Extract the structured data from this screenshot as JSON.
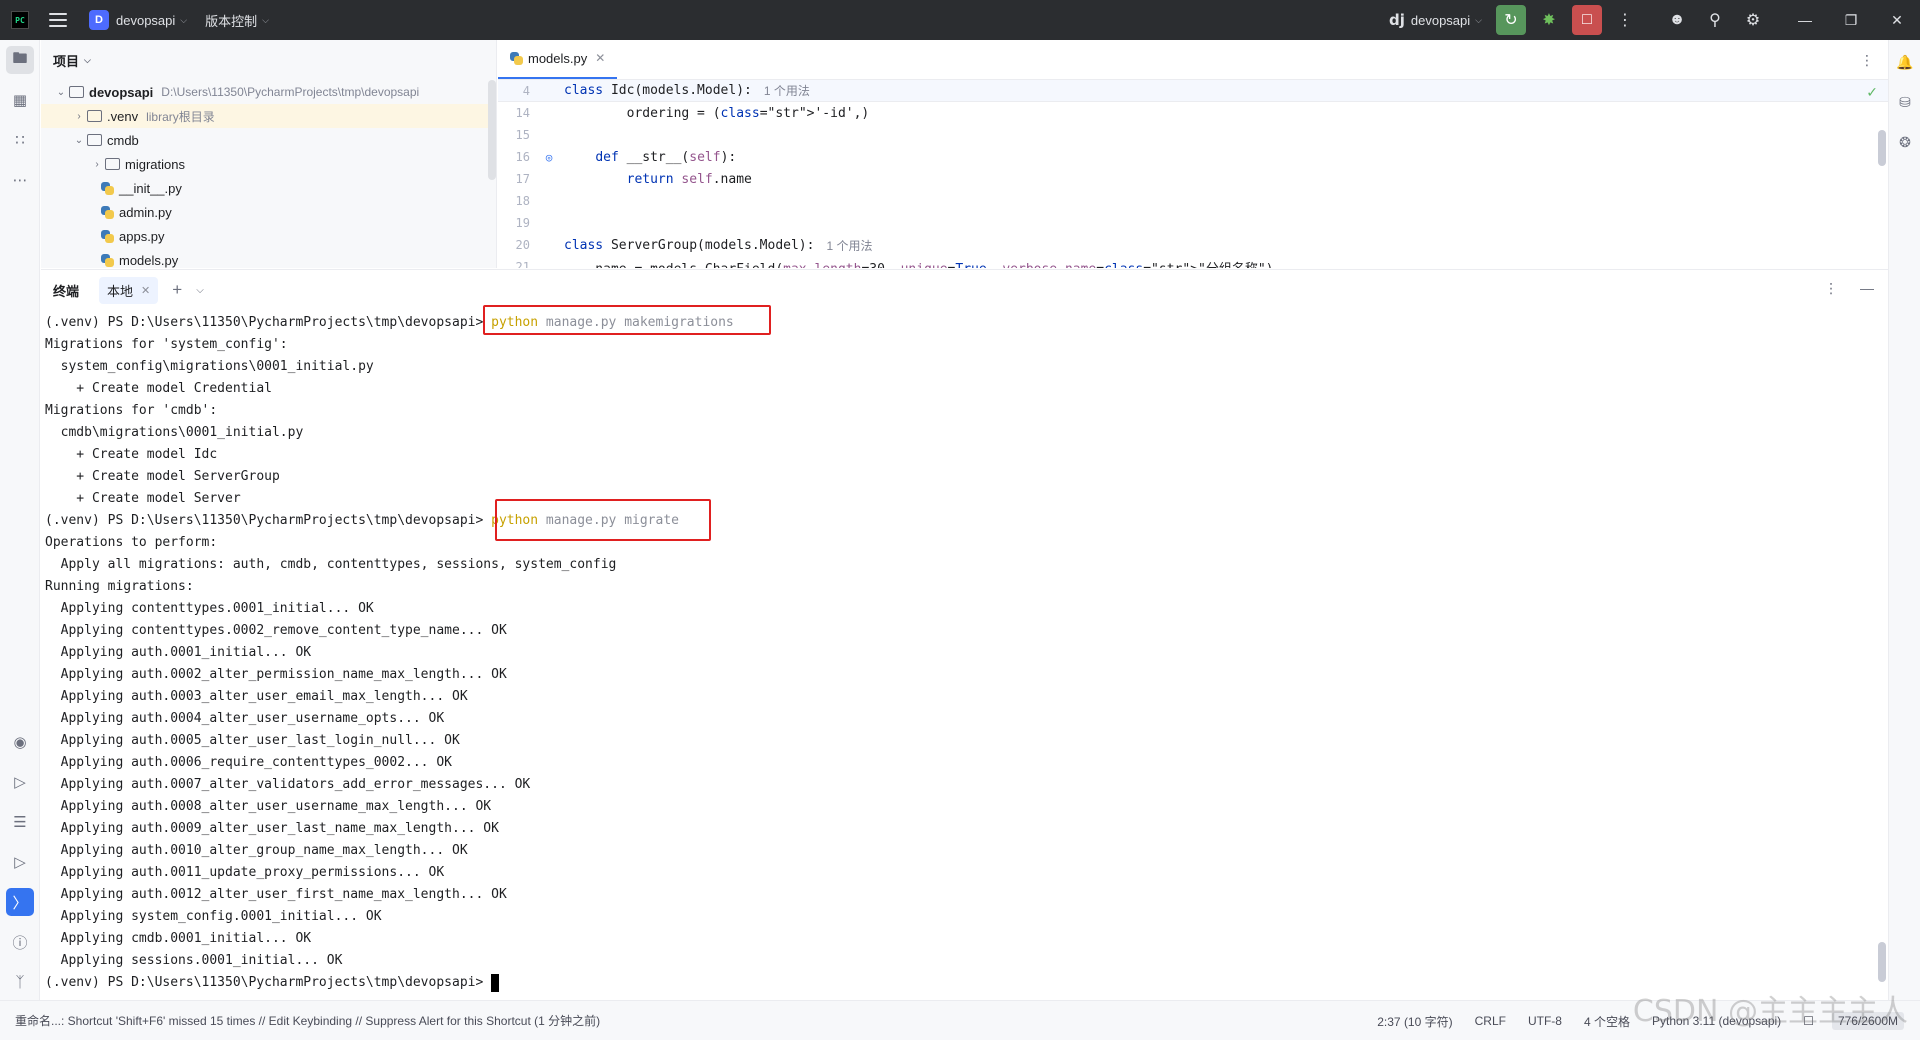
{
  "titlebar": {
    "logo": "PC",
    "project_badge": "D",
    "project_name": "devopsapi",
    "vcs_label": "版本控制",
    "dj_logo": "dj",
    "run_config": "devopsapi",
    "icons": [
      "hamburger-menu-icon",
      "rerun-icon",
      "debug-icon",
      "stop-icon",
      "more-icon",
      "add-user-icon",
      "search-icon",
      "gear-icon",
      "minimize-icon",
      "restore-icon",
      "close-icon"
    ]
  },
  "project_panel": {
    "title": "项目",
    "tree": [
      {
        "label": "devopsapi",
        "hint": "D:\\Users\\11350\\PycharmProjects\\tmp\\devopsapi",
        "type": "folder",
        "expanded": true
      },
      {
        "label": ".venv",
        "hint": "library根目录",
        "type": "folder",
        "expanded": false
      },
      {
        "label": "cmdb",
        "hint": "",
        "type": "folder",
        "expanded": true
      },
      {
        "label": "migrations",
        "hint": "",
        "type": "folder",
        "expanded": false
      },
      {
        "label": "__init__.py",
        "hint": "",
        "type": "py"
      },
      {
        "label": "admin.py",
        "hint": "",
        "type": "py"
      },
      {
        "label": "apps.py",
        "hint": "",
        "type": "py"
      },
      {
        "label": "models.py",
        "hint": "",
        "type": "py"
      }
    ]
  },
  "editor": {
    "tab_label": "models.py",
    "sticky": {
      "num": "4",
      "code": "class Idc(models.Model):",
      "usage": "1 个用法"
    },
    "lines": [
      {
        "num": "14",
        "code": "        ordering = ('-id',)"
      },
      {
        "num": "15",
        "code": ""
      },
      {
        "num": "16",
        "code": "    def __str__(self):"
      },
      {
        "num": "17",
        "code": "        return self.name"
      },
      {
        "num": "18",
        "code": ""
      },
      {
        "num": "19",
        "code": ""
      },
      {
        "num": "20",
        "code": "class ServerGroup(models.Model):",
        "usage": "1 个用法"
      },
      {
        "num": "21",
        "code": "    name = models.CharField(max_length=30, unique=True, verbose_name=\"分组名称\")"
      }
    ]
  },
  "terminal": {
    "title": "终端",
    "tab_label": "本地",
    "prompt": "(.venv) PS D:\\Users\\11350\\PycharmProjects\\tmp\\devopsapi>",
    "cmd1_keyword": "python",
    "cmd1_rest": "manage.py makemigrations",
    "cmd2_keyword": "python",
    "cmd2_rest": "manage.py migrate",
    "output1": [
      "Migrations for 'system_config':",
      "  system_config\\migrations\\0001_initial.py",
      "    + Create model Credential",
      "Migrations for 'cmdb':",
      "  cmdb\\migrations\\0001_initial.py",
      "    + Create model Idc",
      "    + Create model ServerGroup",
      "    + Create model Server"
    ],
    "output2": [
      "Operations to perform:",
      "  Apply all migrations: auth, cmdb, contenttypes, sessions, system_config",
      "Running migrations:",
      "  Applying contenttypes.0001_initial... OK",
      "  Applying contenttypes.0002_remove_content_type_name... OK",
      "  Applying auth.0001_initial... OK",
      "  Applying auth.0002_alter_permission_name_max_length... OK",
      "  Applying auth.0003_alter_user_email_max_length... OK",
      "  Applying auth.0004_alter_user_username_opts... OK",
      "  Applying auth.0005_alter_user_last_login_null... OK",
      "  Applying auth.0006_require_contenttypes_0002... OK",
      "  Applying auth.0007_alter_validators_add_error_messages... OK",
      "  Applying auth.0008_alter_user_username_max_length... OK",
      "  Applying auth.0009_alter_user_last_name_max_length... OK",
      "  Applying auth.0010_alter_group_name_max_length... OK",
      "  Applying auth.0011_update_proxy_permissions... OK",
      "  Applying auth.0012_alter_user_first_name_max_length... OK",
      "  Applying system_config.0001_initial... OK",
      "  Applying cmdb.0001_initial... OK",
      "  Applying sessions.0001_initial... OK"
    ]
  },
  "statusbar": {
    "message": "重命名...: Shortcut 'Shift+F6' missed 15 times // Edit Keybinding // Suppress Alert for this Shortcut (1 分钟之前)",
    "position": "2:37 (10 字符)",
    "line_sep": "CRLF",
    "encoding": "UTF-8",
    "indent": "4 个空格",
    "interpreter": "Python 3.11 (devopsapi)",
    "memory": "776/2600M"
  },
  "watermark": "CSDN @主主主主人",
  "colors": {
    "accent": "#3574f0",
    "highlight_box": "#e02020",
    "command_keyword": "#c7a100"
  }
}
